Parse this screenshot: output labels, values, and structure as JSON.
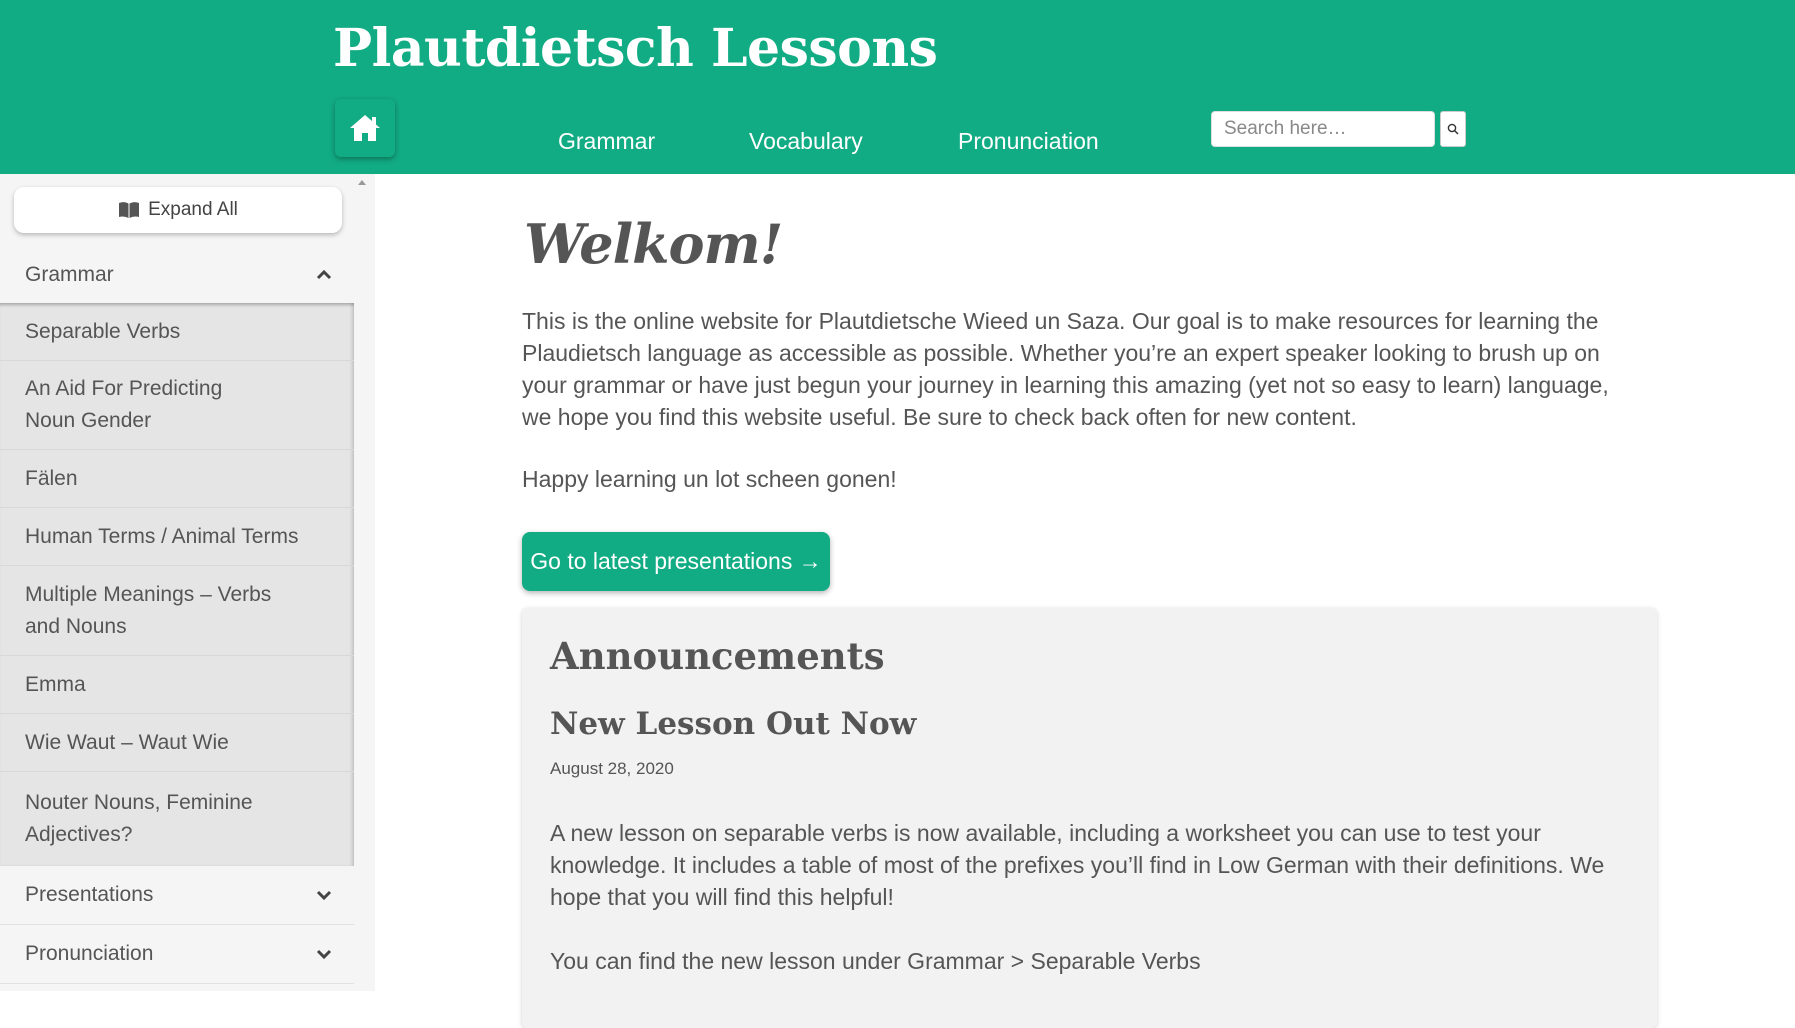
{
  "header": {
    "title": "Plautdietsch Lessons",
    "nav": [
      "Grammar",
      "Vocabulary",
      "Pronunciation"
    ],
    "search_placeholder": "Search here…"
  },
  "sidebar": {
    "expand_label": "Expand All",
    "sections": [
      {
        "label": "Grammar",
        "expanded": true
      },
      {
        "label": "Presentations",
        "expanded": false
      },
      {
        "label": "Pronunciation",
        "expanded": false
      }
    ],
    "grammar_items": [
      "Separable Verbs",
      "An Aid For Predicting Noun Gender",
      "Fälen",
      "Human Terms / Animal Terms",
      "Multiple Meanings – Verbs and Nouns",
      "Emma",
      "Wie Waut – Waut Wie",
      "Nouter Nouns, Feminine Adjectives?"
    ]
  },
  "main": {
    "heading": "Welkom!",
    "intro": "This is the online website for Plautdietsche Wieed un Saza. Our goal is to make resources for learning the Plaudietsch language as accessible as possible. Whether you’re an expert speaker looking to brush up on your grammar or have just begun your journey in learning this amazing (yet not so easy to learn) language, we hope you find this website useful. Be sure to check back often for new content.",
    "closing": "Happy learning un lot scheen gonen!",
    "cta_label": "Go to latest presentations →",
    "announcements": {
      "title": "Announcements",
      "post_title": "New Lesson Out Now",
      "post_date": "August 28, 2020",
      "post_body": "A new lesson on separable verbs is now available, including a worksheet you can use to test your knowledge. It includes a table of most of the prefixes you’ll find in Low German with their definitions. We hope that you will find this helpful!",
      "post_more": "You can find the new lesson under Grammar > Separable Verbs"
    }
  },
  "colors": {
    "brand": "#12ac84",
    "text": "#555555",
    "sidebar_bg": "#f5f5f5",
    "submenu_bg": "#e5e5e5"
  },
  "icons": [
    "home-icon",
    "search-icon",
    "book-icon",
    "chevron-up-icon",
    "chevron-down-icon",
    "arrow-right-icon"
  ]
}
